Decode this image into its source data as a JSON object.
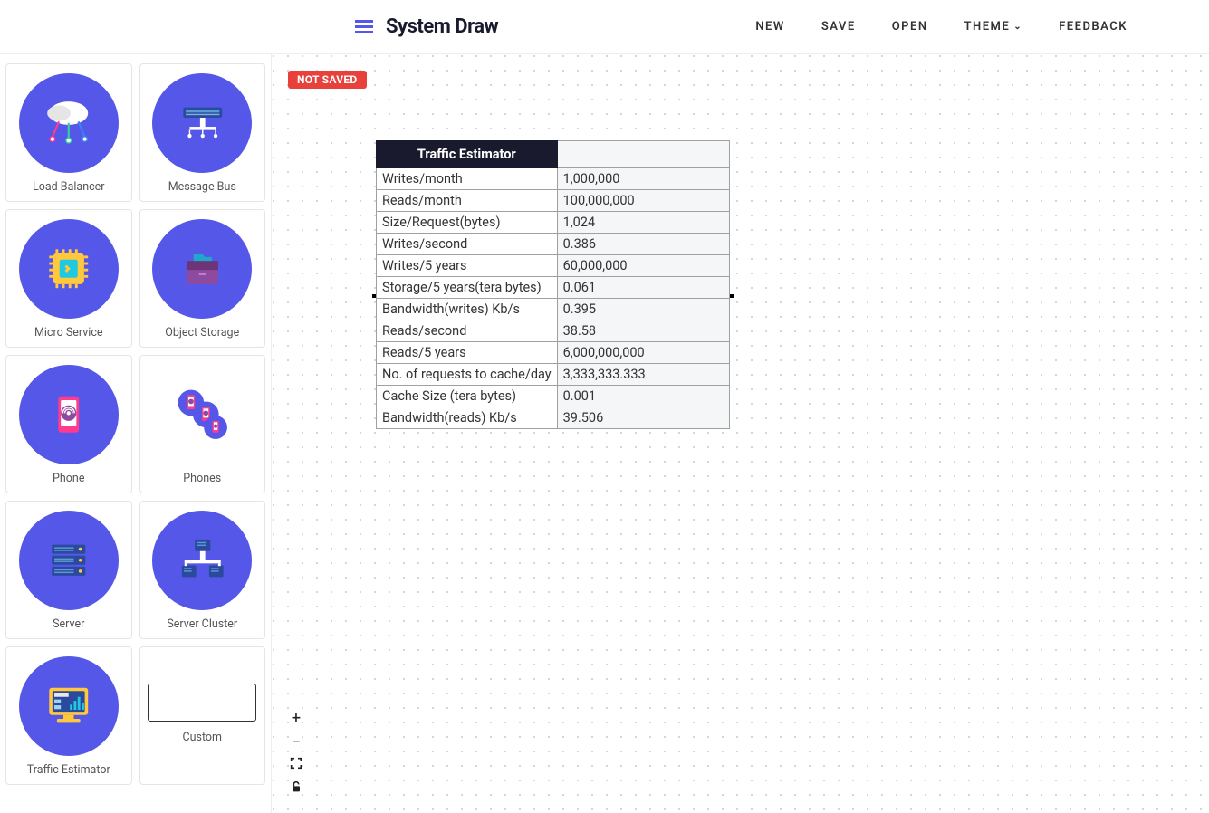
{
  "header": {
    "app_title": "System Draw",
    "nav": {
      "new": "NEW",
      "save": "SAVE",
      "open": "OPEN",
      "theme": "THEME",
      "feedback": "FEEDBACK"
    }
  },
  "sidebar": {
    "items": [
      {
        "label": "Load Balancer",
        "icon": "load-balancer"
      },
      {
        "label": "Message Bus",
        "icon": "message-bus"
      },
      {
        "label": "Micro Service",
        "icon": "micro-service"
      },
      {
        "label": "Object Storage",
        "icon": "object-storage"
      },
      {
        "label": "Phone",
        "icon": "phone"
      },
      {
        "label": "Phones",
        "icon": "phones"
      },
      {
        "label": "Server",
        "icon": "server"
      },
      {
        "label": "Server Cluster",
        "icon": "server-cluster"
      },
      {
        "label": "Traffic Estimator",
        "icon": "traffic-estimator"
      },
      {
        "label": "Custom",
        "icon": "custom"
      }
    ]
  },
  "canvas": {
    "status_badge": "NOT SAVED",
    "table": {
      "title": "Traffic Estimator",
      "rows": [
        {
          "label": "Writes/month",
          "value": "1,000,000"
        },
        {
          "label": "Reads/month",
          "value": "100,000,000"
        },
        {
          "label": "Size/Request(bytes)",
          "value": "1,024"
        },
        {
          "label": "Writes/second",
          "value": "0.386"
        },
        {
          "label": "Writes/5 years",
          "value": "60,000,000"
        },
        {
          "label": "Storage/5 years(tera bytes)",
          "value": "0.061"
        },
        {
          "label": "Bandwidth(writes) Kb/s",
          "value": "0.395"
        },
        {
          "label": "Reads/second",
          "value": "38.58"
        },
        {
          "label": "Reads/5 years",
          "value": "6,000,000,000"
        },
        {
          "label": "No. of requests to cache/day",
          "value": "3,333,333.333"
        },
        {
          "label": "Cache Size (tera bytes)",
          "value": "0.001"
        },
        {
          "label": "Bandwidth(reads) Kb/s",
          "value": "39.506"
        }
      ]
    }
  }
}
